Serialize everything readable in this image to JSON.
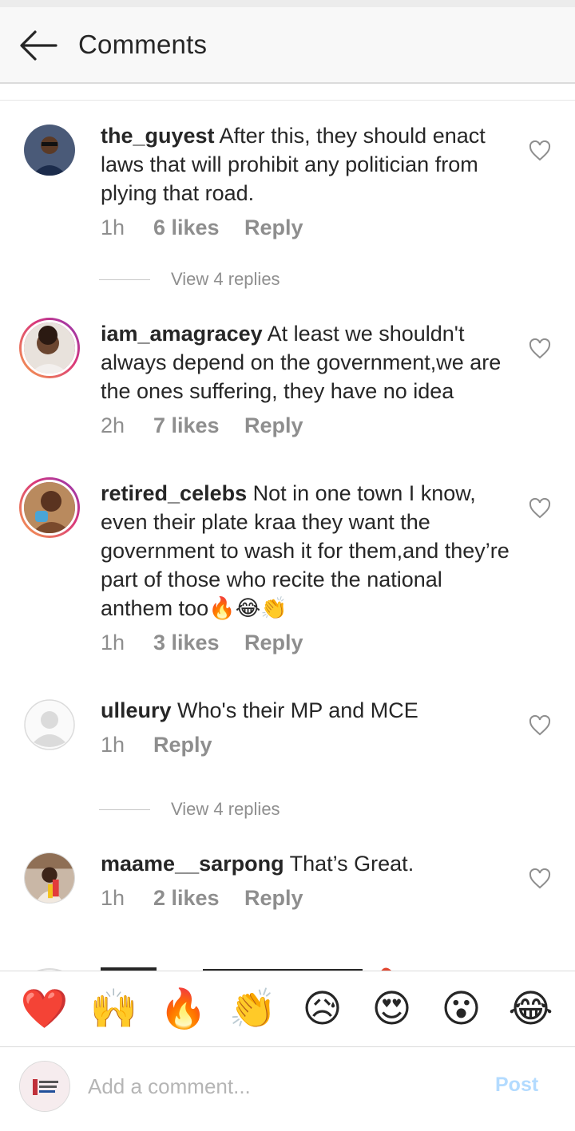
{
  "header": {
    "title": "Comments"
  },
  "comments": [
    {
      "username": "the_guyest",
      "text": " After this, they should enact laws that will prohibit any politician from plying that road.",
      "time": "1h",
      "likes": "6 likes",
      "reply": "Reply"
    },
    {
      "username": "iam_amagracey",
      "text": " At least we shouldn't always depend on the government,we are the ones suffering, they have no idea",
      "time": "2h",
      "likes": "7 likes",
      "reply": "Reply"
    },
    {
      "username": "retired_celebs",
      "text": " Not in one town I know, even their plate kraa they want the government to wash it for them,and they’re part of those who recite the national anthem too🔥😂👏",
      "time": "1h",
      "likes": "3 likes",
      "reply": "Reply"
    },
    {
      "username": "ulleury",
      "text": " Who's their MP and MCE",
      "time": "1h",
      "likes": "",
      "reply": "Reply"
    },
    {
      "username": "maame__sarpong",
      "text": " That’s Great.",
      "time": "1h",
      "likes": "2 likes",
      "reply": "Reply"
    }
  ],
  "view_replies": [
    "View 4 replies",
    "View 4 replies"
  ],
  "emoji_bar": [
    "❤️",
    "🙌",
    "🔥",
    "👏",
    "😥",
    "😍",
    "😮",
    "😂"
  ],
  "composer": {
    "placeholder": "Add a comment...",
    "post_label": "Post"
  },
  "colors": {
    "text": "#262626",
    "meta": "#8e8e8e",
    "post_disabled": "#b3dbff",
    "divider": "#dbdbdb"
  },
  "icons": {
    "back": "arrow-left-icon",
    "like": "heart-outline-icon"
  }
}
